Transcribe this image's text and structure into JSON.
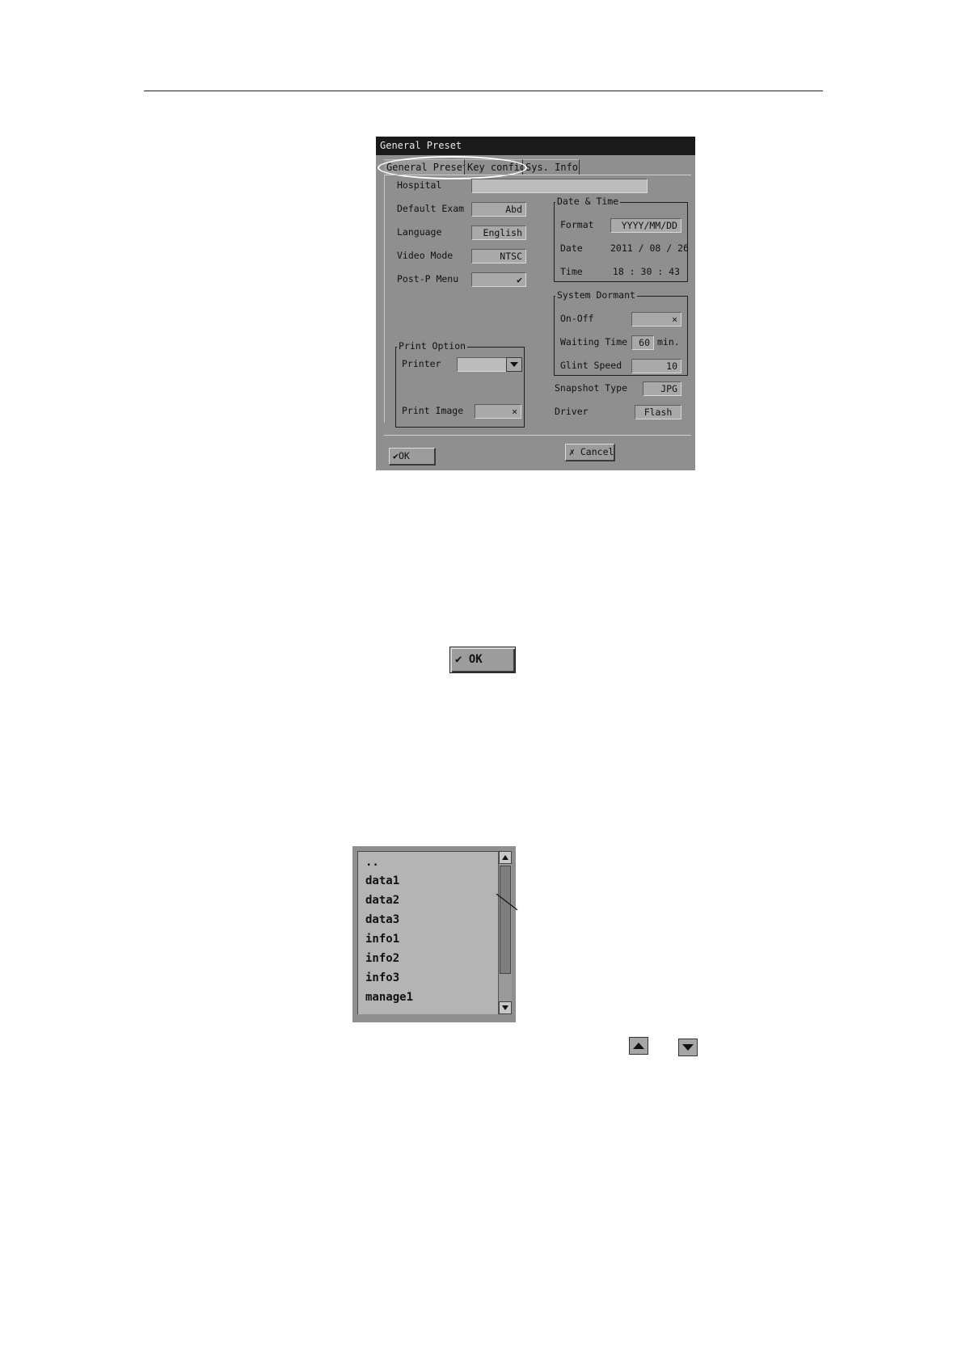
{
  "dialog": {
    "title": "General Preset",
    "tabs": [
      "General Preset",
      "Key config",
      "Sys. Info"
    ],
    "fields": {
      "hospital": {
        "label": "Hospital",
        "value": ""
      },
      "default_exam": {
        "label": "Default Exam",
        "value": "Abd"
      },
      "language": {
        "label": "Language",
        "value": "English"
      },
      "video_mode": {
        "label": "Video Mode",
        "value": "NTSC"
      },
      "postp_menu": {
        "label": "Post-P Menu",
        "value": "✔"
      }
    },
    "date_time": {
      "title": "Date & Time",
      "format_label": "Format",
      "format_value": "YYYY/MM/DD",
      "date_label": "Date",
      "date_value": "2011 / 08 / 26",
      "time_label": "Time",
      "time_value": "18 : 30 : 43"
    },
    "system_dormant": {
      "title": "System Dormant",
      "onoff_label": "On-Off",
      "onoff_value": "×",
      "waiting_label": "Waiting Time",
      "waiting_value": "60",
      "waiting_unit": "min.",
      "glint_label": "Glint Speed",
      "glint_value": "10"
    },
    "snapshot": {
      "label": "Snapshot Type",
      "value": "JPG"
    },
    "driver": {
      "label": "Driver",
      "value": "Flash"
    },
    "print_option": {
      "title": "Print Option",
      "printer_label": "Printer",
      "printer_value": "",
      "print_image_label": "Print Image",
      "print_image_value": "×"
    },
    "ok_label": "OK",
    "cancel_label": "Cancel",
    "ok_icon": "check-icon",
    "cancel_icon": "x-icon"
  },
  "ok_button_large": {
    "label": "OK"
  },
  "file_list": {
    "items": [
      "..",
      "data1",
      "data2",
      "data3",
      "info1",
      "info2",
      "info3",
      "manage1"
    ]
  },
  "colors": {
    "dialog_bg": "#8f8f8f",
    "titlebar": "#1a1a1a",
    "field": "#a9a9a9"
  }
}
